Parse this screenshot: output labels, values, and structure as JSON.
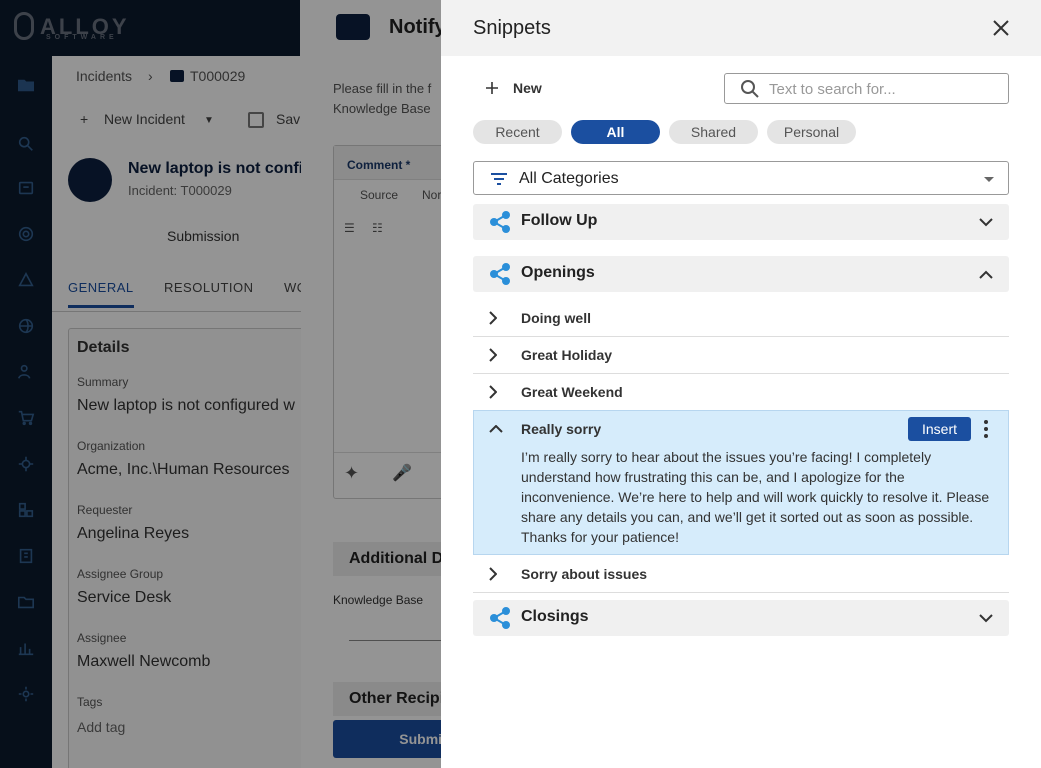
{
  "app": {
    "logo_text": "ALLOY",
    "logo_sub": "SOFTWARE"
  },
  "rail": {
    "icons": [
      "folder-icon",
      "search-icon",
      "ticket-icon",
      "gear-icon",
      "warning-icon",
      "globe-icon",
      "user-settings-icon",
      "cart-icon",
      "bug-icon",
      "puzzle-icon",
      "building-icon",
      "folder-outline-icon",
      "bar-chart-icon",
      "settings-icon"
    ]
  },
  "incident": {
    "breadcrumb": {
      "parent": "Incidents",
      "current": "T000029"
    },
    "toolbar": {
      "new_incident": "New Incident",
      "save": "Sav"
    },
    "title": "New laptop is not configured",
    "subtitle": "Incident: T000029",
    "submission": "Submission",
    "tabs": [
      "GENERAL",
      "RESOLUTION",
      "WO"
    ],
    "details": {
      "heading": "Details",
      "fields": [
        {
          "label": "Summary",
          "value": "New laptop is not configured w"
        },
        {
          "label": "Organization",
          "value": "Acme, Inc.\\Human Resources"
        },
        {
          "label": "Requester",
          "value": "Angelina Reyes"
        },
        {
          "label": "Assignee Group",
          "value": "Service Desk"
        },
        {
          "label": "Assignee",
          "value": "Maxwell Newcomb"
        },
        {
          "label": "Tags",
          "value": "Add tag"
        }
      ]
    }
  },
  "notify": {
    "title": "Notify",
    "instructions_1": "Please fill in the f",
    "instructions_2": "Knowledge Base",
    "comment_label": "Comment *",
    "source_label": "Source",
    "normal_label": "Nor",
    "additional_heading": "Additional De",
    "kb_label": "Knowledge Base",
    "other_heading": "Other Recipi",
    "submit_label": "Submit"
  },
  "snippets": {
    "title": "Snippets",
    "new_label": "New",
    "search_placeholder": "Text to search for...",
    "filters": [
      {
        "label": "Recent",
        "active": false
      },
      {
        "label": "All",
        "active": true
      },
      {
        "label": "Shared",
        "active": false
      },
      {
        "label": "Personal",
        "active": false
      }
    ],
    "category_select": "All Categories",
    "groups": [
      {
        "name": "Follow Up",
        "expanded": false
      },
      {
        "name": "Openings",
        "expanded": true,
        "items": [
          {
            "name": "Doing well"
          },
          {
            "name": "Great Holiday"
          },
          {
            "name": "Great Weekend"
          },
          {
            "name": "Really sorry",
            "expanded": true,
            "text": "I’m really sorry to hear about the issues you’re facing! I completely understand how frustrating this can be, and I apologize for the inconvenience. We’re here to help and will work quickly to resolve it. Please share any details you can, and we’ll get it sorted out as soon as possible. Thanks for your patience!"
          },
          {
            "name": "Sorry about issues"
          }
        ]
      },
      {
        "name": "Closings",
        "expanded": false
      }
    ],
    "insert_label": "Insert",
    "accent_color": "#1b4fa0",
    "highlight_color": "#d6ecfb",
    "group_icon_color": "#2b8fd9"
  }
}
